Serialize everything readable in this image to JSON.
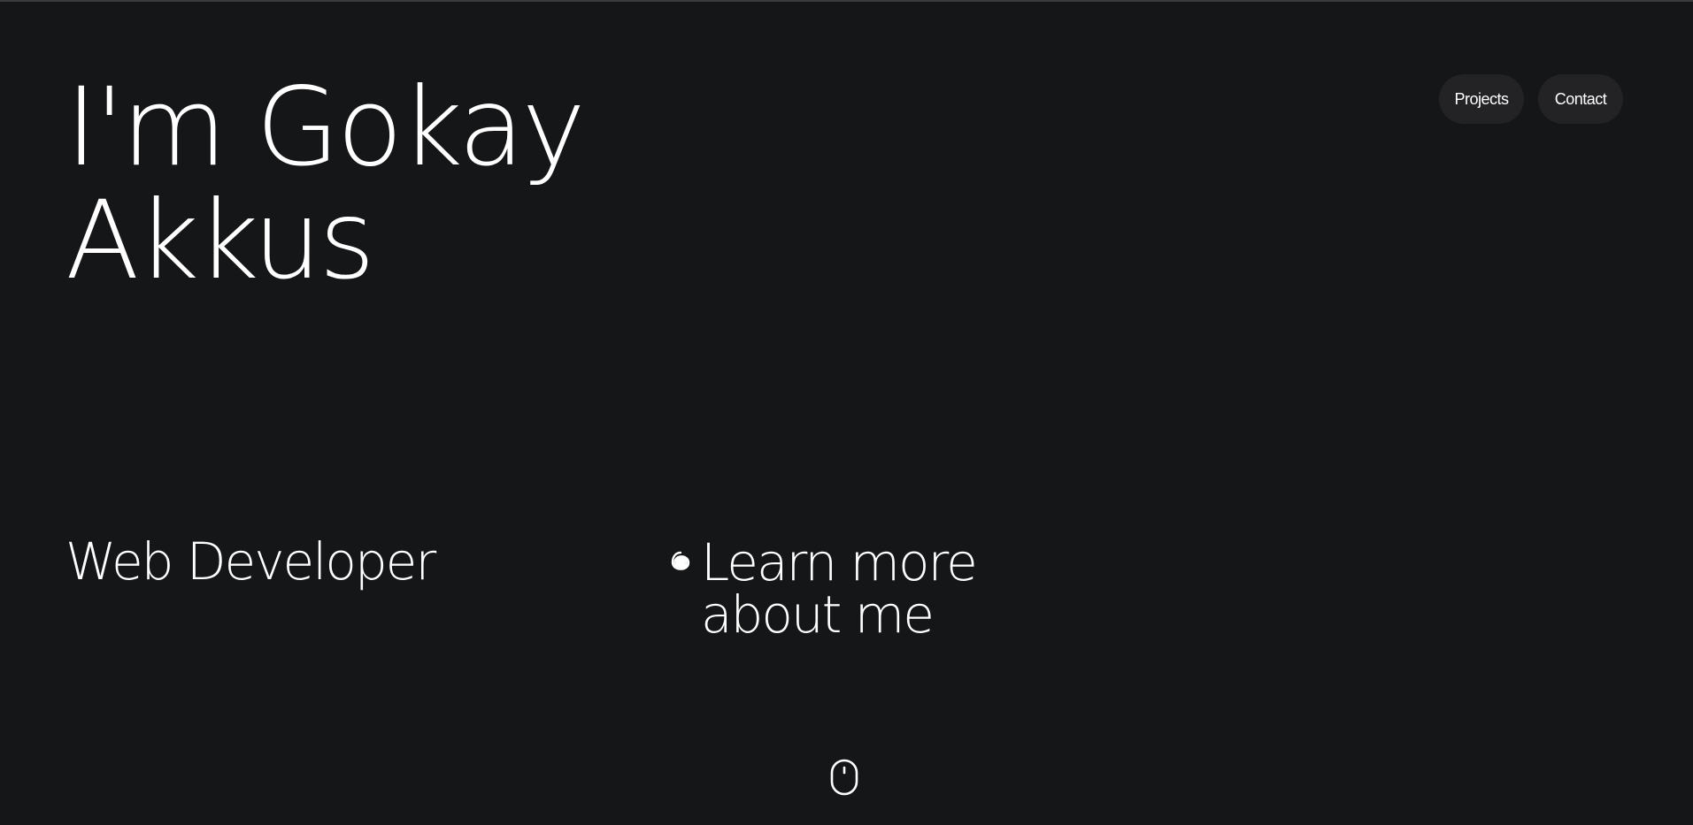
{
  "hero": {
    "line1": "I'm Gokay",
    "line2": "Akkus"
  },
  "nav": {
    "projects_label": "Projects",
    "contact_label": "Contact"
  },
  "role": {
    "text": "Web Developer"
  },
  "learn_more": {
    "line1": "Learn more",
    "line2": "about me",
    "icon": "spiral-icon"
  },
  "scroll_indicator": {
    "icon": "mouse-icon"
  },
  "colors": {
    "background": "#151618",
    "pill_background": "#232325",
    "text": "#ffffff"
  }
}
